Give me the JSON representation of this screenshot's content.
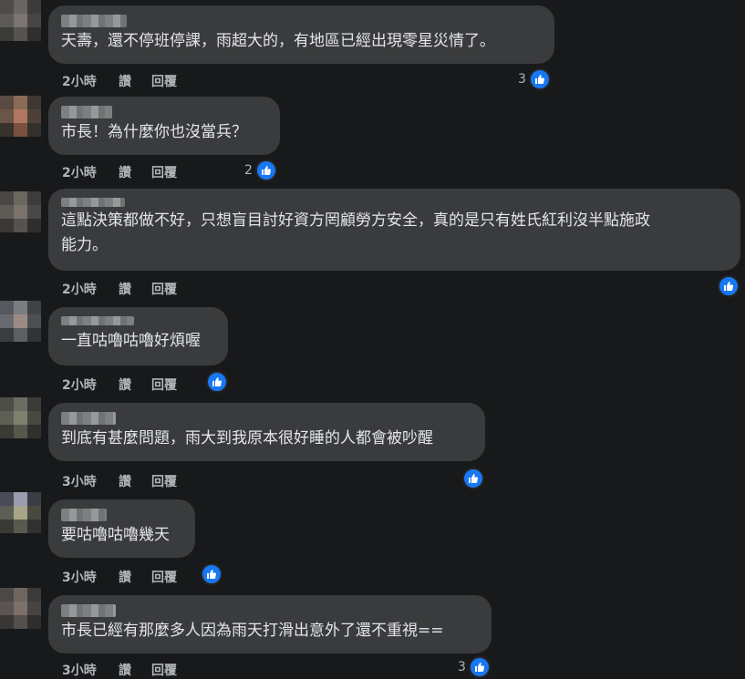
{
  "actions": {
    "like": "讚",
    "reply": "回覆"
  },
  "comments": [
    {
      "text": "天壽，還不停班停課，雨超大的，有地區已經出現零星災情了。",
      "time": "2小時",
      "reactions": "3"
    },
    {
      "text": "市長！為什麼你也沒當兵？",
      "time": "2小時",
      "reactions": "2"
    },
    {
      "text": "這點決策都做不好，只想盲目討好資方罔顧勞方安全，真的是只有姓氏紅利沒半點施政\n能力。",
      "time": "2小時",
      "reactions": ""
    },
    {
      "text": "一直咕嚕咕嚕好煩喔",
      "time": "2小時",
      "reactions": ""
    },
    {
      "text": "到底有甚麼問題，雨大到我原本很好睡的人都會被吵醒",
      "time": "3小時",
      "reactions": ""
    },
    {
      "text": "要咕嚕咕嚕幾天",
      "time": "3小時",
      "reactions": ""
    },
    {
      "text": "市長已經有那麼多人因為雨天打滑出意外了還不重視==",
      "time": "3小時",
      "reactions": "3"
    }
  ],
  "icons": {
    "reaction": "thumbs-up-icon",
    "avatar": "blurred-avatar"
  },
  "colors": {
    "accent": "#1877f2",
    "bubble": "#3a3b3c",
    "background": "#18191a"
  }
}
